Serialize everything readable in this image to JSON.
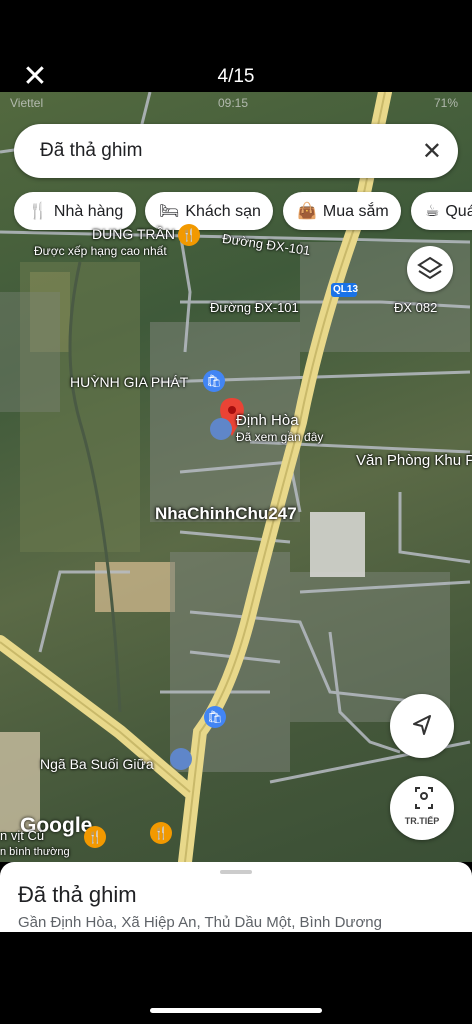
{
  "viewer": {
    "close_icon": "close-icon",
    "counter": "4/15"
  },
  "status_bar": {
    "carrier": "Viettel",
    "time": "09:15",
    "battery": "71%"
  },
  "search": {
    "query": "Đã thả ghim",
    "clear_icon": "close-icon"
  },
  "chips": [
    {
      "icon": "restaurant-icon",
      "label": "Nhà hàng"
    },
    {
      "icon": "hotel-icon",
      "label": "Khách sạn"
    },
    {
      "icon": "shopping-bag-icon",
      "label": "Mua sắm"
    },
    {
      "icon": "coffee-icon",
      "label": "Quá"
    }
  ],
  "map": {
    "labels": {
      "dung_tran": "DUNG TRẦN",
      "dung_tran_sub": "Được xếp hạng cao nhất",
      "road_dx101_a": "Đường ĐX-101",
      "road_dx101_b": "Đường ĐX-101",
      "ql13": "QL13",
      "dx082": "ĐX 082",
      "huynh_gia_phat": "HUỲNH GIA PHÁT",
      "dinh_hoa": "Định Hòa",
      "dinh_hoa_sub": "Đã xem gần đây",
      "van_phong": "Văn Phòng Khu P",
      "nga_ba": "Ngã Ba Suối Giữa",
      "left_partial": "n vịt Củ",
      "left_partial_sub": "n bình thường"
    },
    "watermark": "NhaChinhChu247",
    "google_logo": "Google",
    "street_view_label": "TR.TIẾP",
    "colors": {
      "road": "#e8d88a",
      "pin": "#ea4335",
      "poi_shop": "#4285f4",
      "poi_food": "#f29900"
    }
  },
  "place": {
    "title": "Đã thả ghim",
    "address": "Gần Định Hòa, Xã Hiệp An, Thủ Dầu Một, Bình Dương"
  }
}
